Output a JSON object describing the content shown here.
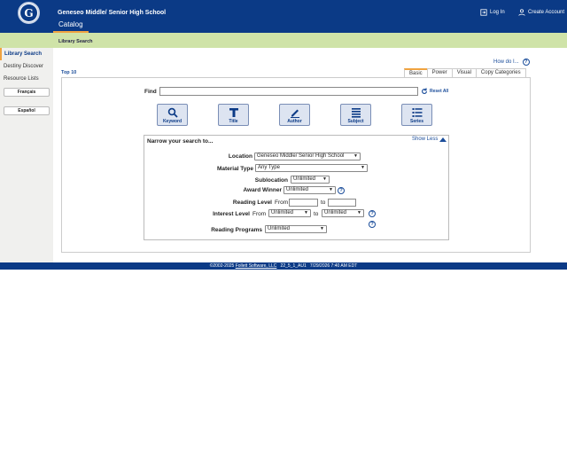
{
  "header": {
    "school_name": "Geneseo Middle/ Senior High School",
    "logo_letter": "G",
    "catalog_tab": "Catalog",
    "login": "Log In",
    "create_account": "Create Account",
    "bg_color": "#0b3a86"
  },
  "subbar": {
    "title": "Library Search",
    "bg_color": "#cfe3a8"
  },
  "sidebar": {
    "items": [
      "Library Search",
      "Destiny Discover",
      "Resource Lists"
    ],
    "lang_buttons": [
      "Français",
      "Español"
    ]
  },
  "howdo": "How do I...",
  "top10": "Top 10",
  "tabs": [
    "Basic",
    "Power",
    "Visual",
    "Copy Categories"
  ],
  "search": {
    "find_label": "Find",
    "find_value": "",
    "reset": "Reset All",
    "buttons": [
      "Keyword",
      "Title",
      "Author",
      "Subject",
      "Series"
    ]
  },
  "narrow": {
    "title": "Narrow your search to...",
    "show_less": "Show Less",
    "location_label": "Location",
    "location_value": "Geneseo Middle/ Senior High School",
    "material_label": "Material Type",
    "material_value": "Any Type",
    "sublocation_label": "Sublocation",
    "sublocation_value": "Unlimited",
    "award_label": "Award Winner",
    "award_value": "Unlimited",
    "reading_level_label": "Reading Level",
    "from": "From",
    "to": "to",
    "interest_label": "Interest Level",
    "interest_from": "Unlimited",
    "interest_to": "Unlimited",
    "programs_label": "Reading Programs",
    "programs_value": "Unlimited"
  },
  "footer": {
    "copyright": "©2002-2025",
    "company": "Follett Software, LLC",
    "version": "22_5_1_AU1",
    "datetime": "7/29/2026 7:40 AM EDT"
  }
}
